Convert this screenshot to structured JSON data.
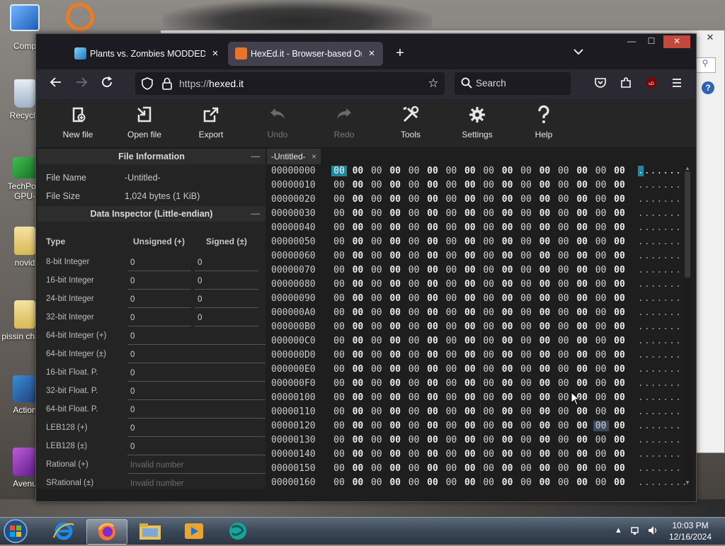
{
  "desktop": {
    "icons": [
      {
        "label": "Comp"
      },
      {
        "label": "Recycle"
      },
      {
        "label": "TechPow GPU-"
      },
      {
        "label": "novid"
      },
      {
        "label": "pissin challe"
      },
      {
        "label": "Action"
      },
      {
        "label": "Avenu"
      }
    ]
  },
  "browser": {
    "tabs": [
      {
        "title": "Plants vs. Zombies MODDED O",
        "close": "×"
      },
      {
        "title": "HexEd.it - Browser-based Onlin",
        "close": "×"
      }
    ],
    "new_tab": "+",
    "tab_list": "⌄",
    "window_controls": {
      "minimize": "—",
      "maximize": "☐",
      "close": "✕"
    },
    "url": {
      "scheme": "https://",
      "host": "hexed.it"
    },
    "search_placeholder": "Search"
  },
  "app": {
    "toolbar": [
      {
        "label": "New file",
        "enabled": true
      },
      {
        "label": "Open file",
        "enabled": true
      },
      {
        "label": "Export",
        "enabled": true
      },
      {
        "label": "Undo",
        "enabled": false
      },
      {
        "label": "Redo",
        "enabled": false
      },
      {
        "label": "Tools",
        "enabled": true
      },
      {
        "label": "Settings",
        "enabled": true
      },
      {
        "label": "Help",
        "enabled": true
      }
    ],
    "file_info": {
      "title": "File Information",
      "collapse": "—",
      "name_label": "File Name",
      "name_value": "-Untitled-",
      "size_label": "File Size",
      "size_value": "1,024 bytes (1 KiB)"
    },
    "inspector": {
      "title": "Data Inspector (Little-endian)",
      "collapse": "—",
      "col_type": "Type",
      "col_unsigned": "Unsigned (+)",
      "col_signed": "Signed (±)",
      "rows": [
        {
          "type": "8-bit Integer",
          "unsigned": "0",
          "signed": "0"
        },
        {
          "type": "16-bit Integer",
          "unsigned": "0",
          "signed": "0"
        },
        {
          "type": "24-bit Integer",
          "unsigned": "0",
          "signed": "0"
        },
        {
          "type": "32-bit Integer",
          "unsigned": "0",
          "signed": "0"
        },
        {
          "type": "64-bit Integer (+)",
          "unsigned": "0"
        },
        {
          "type": "64-bit Integer (±)",
          "unsigned": "0"
        },
        {
          "type": "16-bit Float. P.",
          "unsigned": "0"
        },
        {
          "type": "32-bit Float. P.",
          "unsigned": "0"
        },
        {
          "type": "64-bit Float. P.",
          "unsigned": "0"
        },
        {
          "type": "LEB128 (+)",
          "unsigned": "0"
        },
        {
          "type": "LEB128 (±)",
          "unsigned": "0"
        },
        {
          "type": "Rational (+)",
          "placeholder": "Invalid number"
        },
        {
          "type": "SRational (±)",
          "placeholder": "Invalid number"
        }
      ]
    },
    "hex": {
      "file_tab": "-Untitled-",
      "file_tab_close": "×",
      "offsets": [
        "00000000",
        "00000010",
        "00000020",
        "00000030",
        "00000040",
        "00000050",
        "00000060",
        "00000070",
        "00000080",
        "00000090",
        "000000A0",
        "000000B0",
        "000000C0",
        "000000D0",
        "000000E0",
        "000000F0",
        "00000100",
        "00000110",
        "00000120",
        "00000130",
        "00000140",
        "00000150",
        "00000160"
      ],
      "byte": "00",
      "ascii": "........",
      "selected_offset": "00000000"
    }
  },
  "taskbar": {
    "time": "10:03 PM",
    "date": "12/16/2024"
  }
}
